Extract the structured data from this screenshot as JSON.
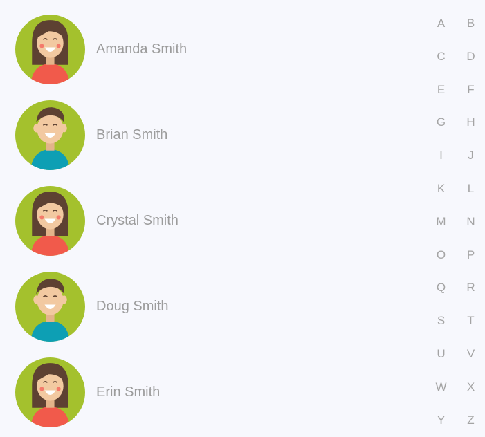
{
  "contacts": [
    {
      "name": "Amanda Smith",
      "avatar": "female-avatar-icon",
      "shirt_color": "#f15a4b"
    },
    {
      "name": "Brian Smith",
      "avatar": "male-avatar-icon",
      "shirt_color": "#0d9fb4"
    },
    {
      "name": "Crystal Smith",
      "avatar": "female-avatar-icon",
      "shirt_color": "#f15a4b"
    },
    {
      "name": "Doug Smith",
      "avatar": "male-avatar-icon",
      "shirt_color": "#0d9fb4"
    },
    {
      "name": "Erin Smith",
      "avatar": "female-avatar-icon",
      "shirt_color": "#f15a4b"
    }
  ],
  "alphabet": [
    "A",
    "B",
    "C",
    "D",
    "E",
    "F",
    "G",
    "H",
    "I",
    "J",
    "K",
    "L",
    "M",
    "N",
    "O",
    "P",
    "Q",
    "R",
    "S",
    "T",
    "U",
    "V",
    "W",
    "X",
    "Y",
    "Z"
  ],
  "colors": {
    "background": "#f7f8fd",
    "avatar_ring": "#a4c12d",
    "hair": "#5d4132",
    "skin": "#f2c9a1",
    "name_text": "#9c9c9c",
    "index_text": "#a4a4a4"
  }
}
